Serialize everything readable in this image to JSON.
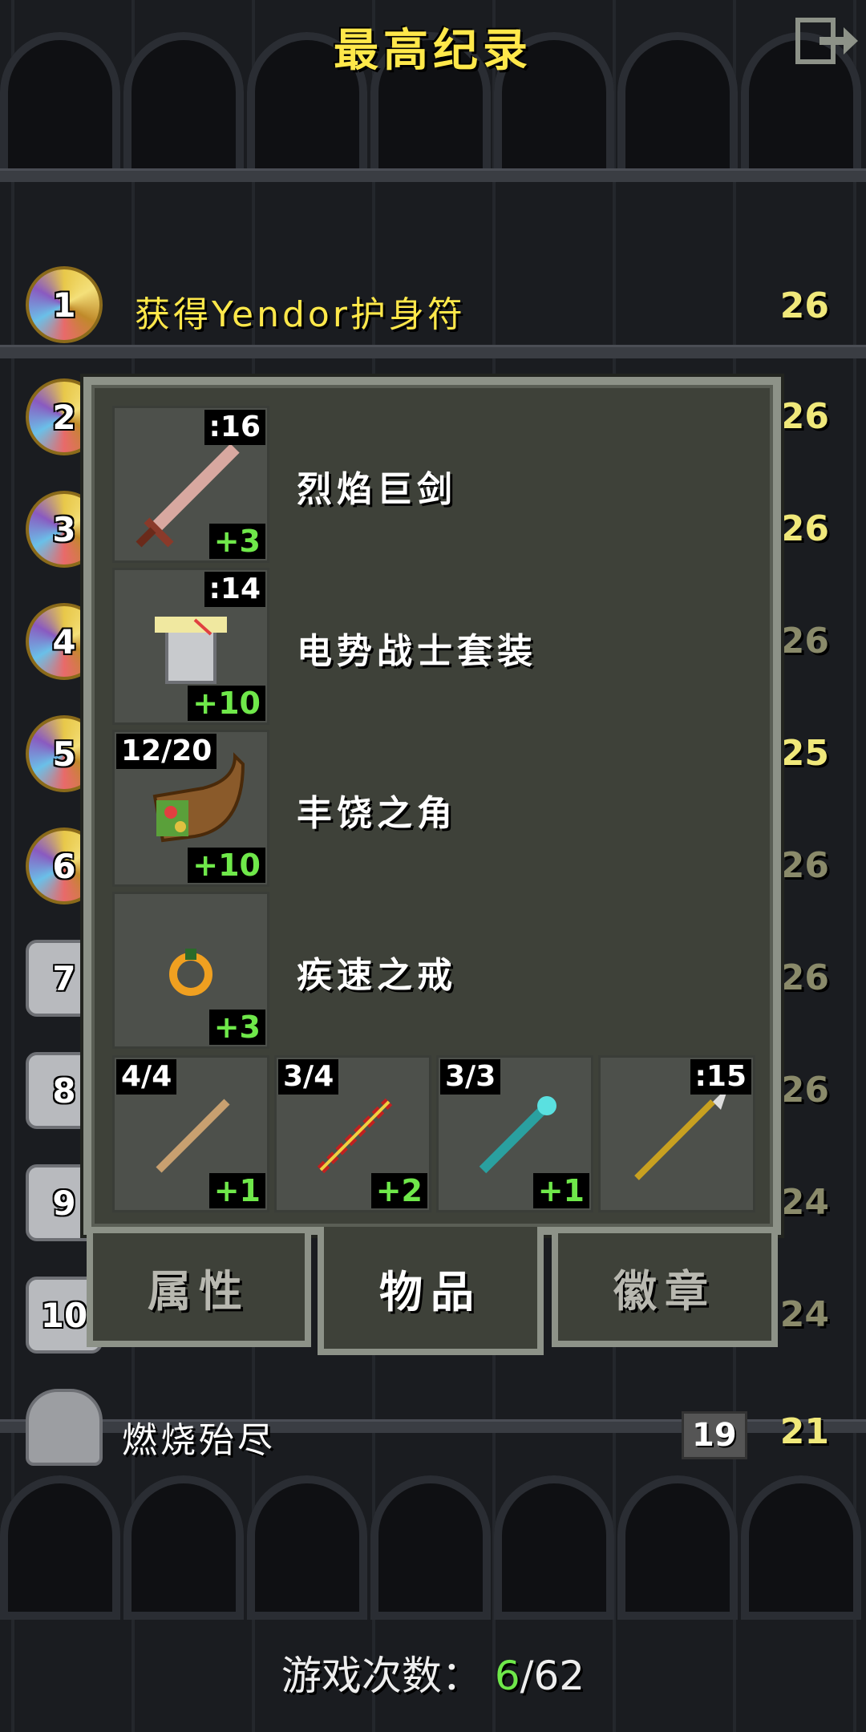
{
  "title": "最高纪录",
  "exit_icon": "exit-icon",
  "records": [
    {
      "rank": "1",
      "text": "获得Yendor护身符",
      "level": "26",
      "badge": "gold"
    },
    {
      "rank": "2",
      "level": "26",
      "badge": "gold"
    },
    {
      "rank": "3",
      "level": "26",
      "badge": "gold"
    },
    {
      "rank": "4",
      "level": "26",
      "badge": "gold"
    },
    {
      "rank": "5",
      "level": "25",
      "badge": "gold"
    },
    {
      "rank": "6",
      "level": "26",
      "badge": "gold"
    },
    {
      "rank": "7",
      "level": "26",
      "badge": "stone"
    },
    {
      "rank": "8",
      "level": "26",
      "badge": "stone"
    },
    {
      "rank": "9",
      "level": "24",
      "badge": "stone"
    },
    {
      "rank": "10",
      "level": "24",
      "badge": "stone"
    },
    {
      "rank": "",
      "text": "燃烧殆尽",
      "depth": "19",
      "level": "21",
      "badge": "tombstone"
    }
  ],
  "dialog": {
    "equipment": [
      {
        "name": "烈焰巨剑",
        "top": ":16",
        "bonus": "+3",
        "icon": "greatsword-icon"
      },
      {
        "name": "电势战士套装",
        "top": ":14",
        "bonus": "+10",
        "icon": "armor-icon"
      },
      {
        "name": "丰饶之角",
        "top": "12/20",
        "bonus": "+10",
        "icon": "horn-of-plenty-icon"
      },
      {
        "name": "疾速之戒",
        "top": "",
        "bonus": "+3",
        "icon": "ring-icon"
      }
    ],
    "quickslots": [
      {
        "top": "4/4",
        "bonus": "+1",
        "icon": "wand-icon"
      },
      {
        "top": "3/4",
        "bonus": "+2",
        "icon": "wand-icon"
      },
      {
        "top": "3/3",
        "bonus": "+1",
        "icon": "wand-icon"
      },
      {
        "top": ":15",
        "bonus": "",
        "icon": "spear-icon"
      }
    ],
    "tabs": {
      "stats": "属性",
      "items": "物品",
      "badges": "徽章"
    }
  },
  "footer": {
    "label": "游戏次数：",
    "current": "6",
    "total": "/62"
  },
  "colors": {
    "title": "#ffe84a",
    "bonus": "#6fe84a",
    "panel": "#3e4139",
    "border": "#8d9288"
  }
}
